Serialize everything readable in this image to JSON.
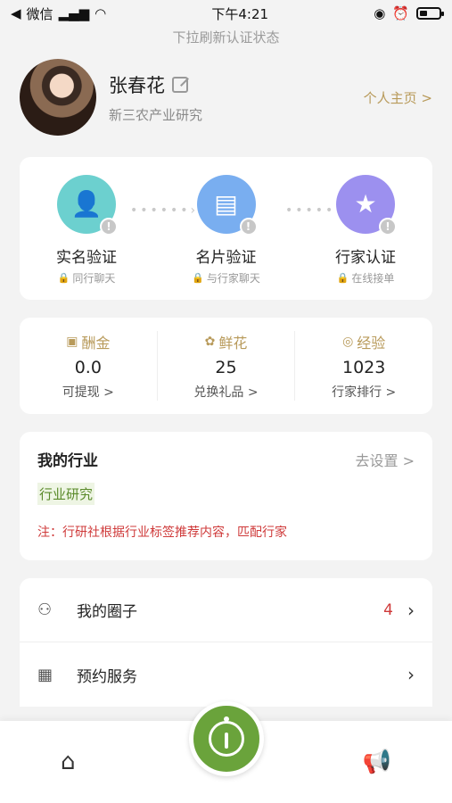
{
  "status_bar": {
    "carrier": "微信",
    "time": "下午4:21"
  },
  "pull_hint": "下拉刷新认证状态",
  "profile": {
    "name": "张春花",
    "subtitle": "新三农产业研究",
    "homepage_link": "个人主页 >"
  },
  "verify_steps": [
    {
      "label": "实名验证",
      "sub": "同行聊天",
      "icon": "id-card-icon",
      "color": "#6cd0cf"
    },
    {
      "label": "名片验证",
      "sub": "与行家聊天",
      "icon": "business-card-icon",
      "color": "#79aef0"
    },
    {
      "label": "行家认证",
      "sub": "在线接单",
      "icon": "award-icon",
      "color": "#9c90ef"
    }
  ],
  "stats": [
    {
      "title": "酬金",
      "value": "0.0",
      "link": "可提现 >",
      "icon": "wallet-icon"
    },
    {
      "title": "鲜花",
      "value": "25",
      "link": "兑换礼品 >",
      "icon": "flower-icon"
    },
    {
      "title": "经验",
      "value": "1023",
      "link": "行家排行 >",
      "icon": "exp-icon"
    }
  ],
  "industry": {
    "title": "我的行业",
    "set_link": "去设置 >",
    "tag": "行业研究",
    "note": "注：行研社根据行业标签推荐内容，匹配行家"
  },
  "menu": [
    {
      "label": "我的圈子",
      "count": "4",
      "icon": "users-icon"
    },
    {
      "label": "预约服务",
      "count": "",
      "icon": "calendar-icon"
    }
  ],
  "tabbar": {
    "left_icon": "home-icon",
    "center_icon": "logo-icon",
    "right_icon": "speaker-icon"
  },
  "colors": {
    "accent_gold": "#b89a5a",
    "accent_green": "#6aa33b",
    "alert_red": "#cf3a3a"
  }
}
